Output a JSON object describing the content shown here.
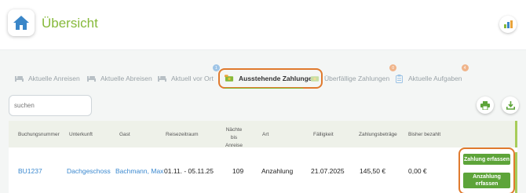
{
  "header": {
    "title": "Übersicht"
  },
  "tabs": [
    {
      "label": "Aktuelle Anreisen",
      "icon": "bed-icon"
    },
    {
      "label": "Aktuelle Abreisen",
      "icon": "bed-icon"
    },
    {
      "label": "Aktuell vor Ort",
      "icon": "bed-icon",
      "badge": "1"
    },
    {
      "label": "Ausstehende Zahlungen",
      "icon": "money-icon",
      "active": true
    },
    {
      "label": "Überfällige Zahlungen",
      "icon": "money-icon",
      "badge": "0"
    },
    {
      "label": "Aktuelle Aufgaben",
      "icon": "clipboard-icon",
      "badge": "4"
    }
  ],
  "search": {
    "placeholder": "suchen"
  },
  "table": {
    "headers": {
      "booking": "Buchungsnummer",
      "accommodation": "Unterkunft",
      "guest": "Gast",
      "period": "Reisezeitraum",
      "nights_1": "Nächte bis",
      "nights_2": "Anreise",
      "type": "Art",
      "due": "Fälligkeit",
      "amount": "Zahlungsbeträge",
      "paid": "Bisher bezahlt"
    },
    "row": {
      "booking": "BU1237",
      "accommodation": "Dachgeschoss",
      "guest": "Bachmann, Max",
      "period": "01.11. - 05.11.25",
      "nights": "109",
      "type": "Anzahlung",
      "due": "21.07.2025",
      "amount": "145,50 €",
      "paid": "0,00 €"
    },
    "actions": {
      "record_payment": "Zahlung erfassen",
      "record_deposit_1": "Anzahlung",
      "record_deposit_2": "erfassen"
    }
  },
  "colors": {
    "accent": "#86b93a",
    "button_green": "#5da439",
    "highlight": "#e07a2e",
    "link": "#3a88cf"
  }
}
